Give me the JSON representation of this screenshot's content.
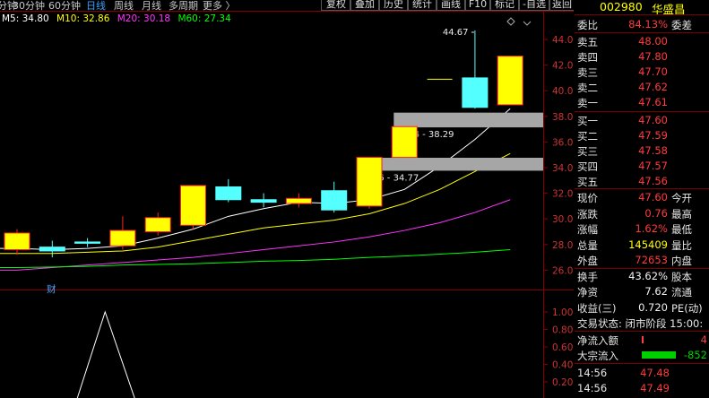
{
  "toolbar": {
    "periods": [
      {
        "label": "分钟",
        "active": false
      },
      {
        "label": "30分钟",
        "active": false
      },
      {
        "label": "60分钟",
        "active": false
      },
      {
        "label": "日线",
        "active": true
      },
      {
        "label": "周线",
        "active": false
      },
      {
        "label": "月线",
        "active": false
      },
      {
        "label": "多周期",
        "active": false
      },
      {
        "label": "更多 〉",
        "active": false
      }
    ],
    "buttons": [
      "复权",
      "叠加",
      "历史",
      "统计",
      "画线",
      "F10",
      "标记",
      "-自选",
      "返回"
    ]
  },
  "ma_legend": [
    {
      "label": "M5: 34.80",
      "color": "#ffffff"
    },
    {
      "label": "M10: 32.86",
      "color": "#ffff00"
    },
    {
      "label": "M20: 30.18",
      "color": "#ff33ff"
    },
    {
      "label": "M60: 27.34",
      "color": "#00ff00"
    }
  ],
  "chart_data": [
    {
      "type": "candlestick",
      "ylim": [
        25.0,
        45.6
      ],
      "y_ticks": [
        "44.00",
        "42.00",
        "40.00",
        "38.00",
        "36.00",
        "34.00",
        "32.00",
        "30.00",
        "28.00",
        "26.00"
      ],
      "candles": [
        {
          "o": 27.6,
          "c": 28.9,
          "h": 29.2,
          "l": 27.2
        },
        {
          "o": 27.8,
          "c": 27.5,
          "h": 28.3,
          "l": 27.0
        },
        {
          "o": 28.2,
          "c": 28.1,
          "h": 28.5,
          "l": 27.8
        },
        {
          "o": 27.9,
          "c": 29.1,
          "h": 30.2,
          "l": 27.6
        },
        {
          "o": 29.0,
          "c": 30.1,
          "h": 30.5,
          "l": 28.7
        },
        {
          "o": 29.5,
          "c": 32.6,
          "h": 32.6,
          "l": 29.2
        },
        {
          "o": 32.5,
          "c": 31.5,
          "h": 33.1,
          "l": 31.3
        },
        {
          "o": 31.5,
          "c": 31.3,
          "h": 32.0,
          "l": 30.9
        },
        {
          "o": 31.2,
          "c": 31.6,
          "h": 32.0,
          "l": 30.9
        },
        {
          "o": 32.2,
          "c": 30.7,
          "h": 32.9,
          "l": 30.5
        },
        {
          "o": 31.0,
          "c": 34.8,
          "h": 34.8,
          "l": 30.8
        },
        {
          "o": 34.8,
          "c": 37.2,
          "h": 37.2,
          "l": 34.8
        },
        {
          "o": 40.9,
          "c": 40.9,
          "h": 40.9,
          "l": 40.9
        },
        {
          "o": 41.0,
          "c": 38.7,
          "h": 44.7,
          "l": 38.6
        },
        {
          "o": 38.9,
          "c": 42.7,
          "h": 42.7,
          "l": 38.9
        }
      ],
      "series": [
        {
          "name": "M5",
          "color": "#ffffff",
          "values": [
            27.7,
            27.6,
            27.7,
            27.9,
            28.5,
            29.2,
            30.2,
            30.8,
            31.3,
            31.2,
            31.5,
            32.3,
            34.1,
            36.2,
            38.6
          ]
        },
        {
          "name": "M10",
          "color": "#ffff00",
          "values": [
            27.3,
            27.3,
            27.4,
            27.5,
            27.8,
            28.3,
            28.8,
            29.3,
            29.6,
            29.9,
            30.4,
            31.2,
            32.3,
            33.7,
            35.1
          ]
        },
        {
          "name": "M20",
          "color": "#ff33ff",
          "values": [
            26.0,
            26.2,
            26.4,
            26.6,
            26.8,
            27.0,
            27.3,
            27.6,
            27.9,
            28.2,
            28.6,
            29.1,
            29.7,
            30.5,
            31.5
          ]
        },
        {
          "name": "M60",
          "color": "#00ff00",
          "values": [
            26.2,
            26.25,
            26.3,
            26.4,
            26.45,
            26.5,
            26.6,
            26.7,
            26.75,
            26.85,
            27.0,
            27.1,
            27.25,
            27.4,
            27.6
          ]
        }
      ],
      "annotations": {
        "high_label": "44.67",
        "gap_upper_label": "37.14 - 38.29",
        "gap_lower_label": "33.76 - 34.77",
        "gap_upper": [
          37.14,
          38.29
        ],
        "gap_lower": [
          33.76,
          34.77
        ],
        "event_marker": "财"
      }
    },
    {
      "type": "line",
      "ylim": [
        0,
        1.1
      ],
      "y_ticks": [
        "1.00",
        "0.80",
        "0.60",
        "0.40",
        "0.20"
      ],
      "series": [
        {
          "color": "#ffffff",
          "x": [
            1.7,
            2.5,
            3.35
          ],
          "values": [
            0,
            1.0,
            0
          ]
        }
      ]
    }
  ],
  "panel": {
    "code": "002980",
    "name": "华盛昌",
    "weibi_label": "委比",
    "weibi_value": "84.13%",
    "weicha_label": "委差",
    "asks": [
      {
        "label": "卖五",
        "price": "48.00"
      },
      {
        "label": "卖四",
        "price": "47.80"
      },
      {
        "label": "卖三",
        "price": "47.70"
      },
      {
        "label": "卖二",
        "price": "47.62"
      },
      {
        "label": "卖一",
        "price": "47.61"
      }
    ],
    "bids": [
      {
        "label": "买一",
        "price": "47.60"
      },
      {
        "label": "买二",
        "price": "47.59"
      },
      {
        "label": "买三",
        "price": "47.58"
      },
      {
        "label": "买四",
        "price": "47.57"
      },
      {
        "label": "买五",
        "price": "47.56"
      }
    ],
    "stats": [
      {
        "label": "现价",
        "value": "47.60",
        "color": "red",
        "label2": "今开"
      },
      {
        "label": "涨跌",
        "value": "0.76",
        "color": "red",
        "label2": "最高"
      },
      {
        "label": "涨幅",
        "value": "1.62%",
        "color": "red",
        "label2": "最低"
      },
      {
        "label": "总量",
        "value": "145409",
        "color": "yellow",
        "label2": "量比"
      },
      {
        "label": "外盘",
        "value": "72653",
        "color": "red",
        "label2": "内盘"
      },
      {
        "label": "换手",
        "value": "43.62%",
        "color": "white",
        "label2": "股本"
      },
      {
        "label": "净资",
        "value": "7.62",
        "color": "white",
        "label2": "流通"
      },
      {
        "label": "收益(三)",
        "value": "0.720",
        "color": "white",
        "label2": "PE(动)"
      }
    ],
    "trade_status": "交易状态: 闭市阶段 15:00:",
    "flows": [
      {
        "label": "净流入额",
        "value": "4",
        "color": "red"
      },
      {
        "label": "大宗流入",
        "value": "-852",
        "color": "green"
      }
    ],
    "ticks": [
      {
        "time": "14:56",
        "price": "47.48"
      },
      {
        "time": "14:56",
        "price": "47.49"
      }
    ]
  }
}
